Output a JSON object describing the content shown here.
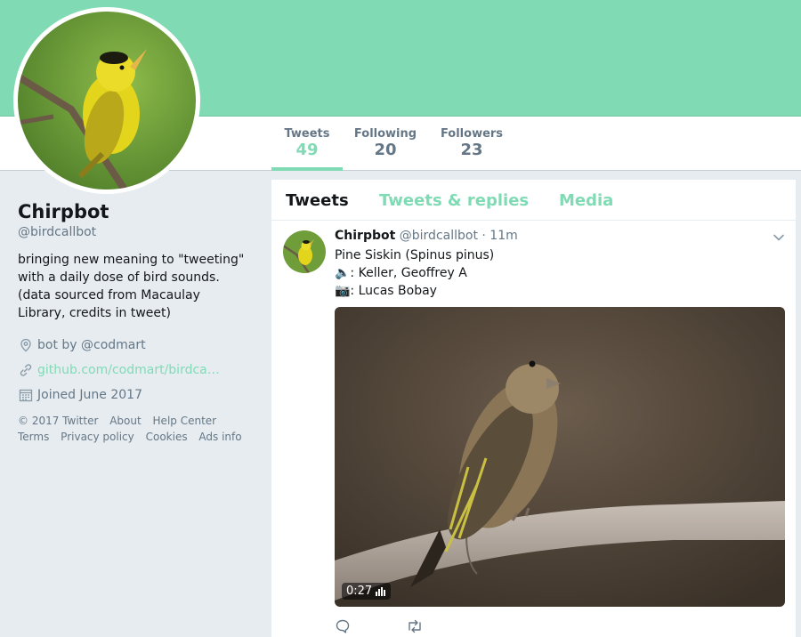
{
  "colors": {
    "accent": "#80dbb5",
    "secondary_text": "#657786",
    "primary_text": "#14171a",
    "background": "#e6ecf0"
  },
  "nav": {
    "stats": [
      {
        "label": "Tweets",
        "value": "49"
      },
      {
        "label": "Following",
        "value": "20"
      },
      {
        "label": "Followers",
        "value": "23"
      }
    ]
  },
  "profile": {
    "name": "Chirpbot",
    "handle": "@birdcallbot",
    "bio": "bringing new meaning to \"tweeting\"\nwith a daily dose of bird sounds.\n(data sourced from Macaulay\nLibrary, credits in tweet)",
    "location": "bot by @codmart",
    "website": "github.com/codmart/birdca…",
    "joined": "Joined June 2017",
    "icons": {
      "location": "location-pin-icon",
      "website": "link-icon",
      "joined": "calendar-icon"
    }
  },
  "footer": {
    "links_row1": [
      "© 2017 Twitter",
      "About",
      "Help Center"
    ],
    "links_row2": [
      "Terms",
      "Privacy policy",
      "Cookies",
      "Ads info"
    ]
  },
  "timeline": {
    "tabs": [
      "Tweets",
      "Tweets & replies",
      "Media"
    ],
    "tweet": {
      "name": "Chirpbot",
      "handle": "@birdcallbot",
      "separator": "·",
      "time": "11m",
      "lines": [
        "Pine Siskin (Spinus pinus)",
        "🔈: Keller, Geoffrey A",
        "📷: Lucas Bobay"
      ],
      "video_duration": "0:27",
      "icons": {
        "reply": "reply-icon",
        "retweet": "retweet-icon",
        "menu": "chevron-down-icon"
      }
    }
  }
}
